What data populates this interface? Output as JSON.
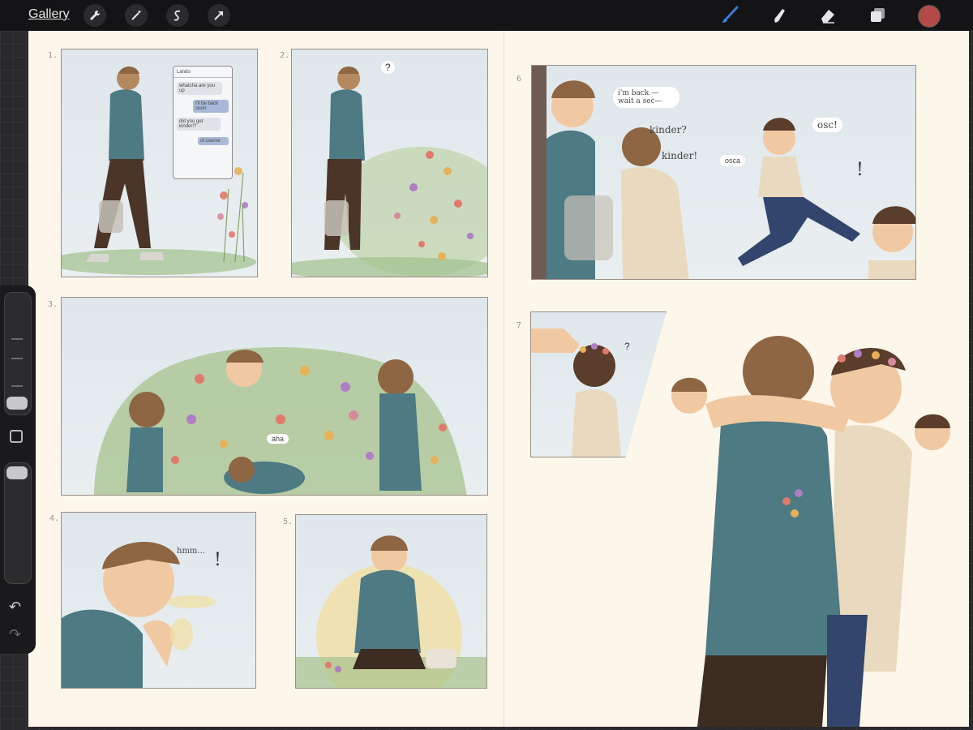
{
  "toolbar": {
    "gallery_label": "Gallery",
    "left_tools": [
      "wrench-icon",
      "magic-wand-icon",
      "selection-icon",
      "transform-arrow-icon"
    ],
    "right_tools": [
      "brush-icon",
      "smudge-icon",
      "eraser-icon",
      "layers-icon"
    ],
    "brush_color": "#b44a48",
    "active_tool_color": "#3a7bd5"
  },
  "panels": {
    "p1_number": "1.",
    "p2_number": "2.",
    "p3_number": "3.",
    "p4_number": "4.",
    "p5_number": "5.",
    "p6_number": "6",
    "p7_number": "7"
  },
  "phone_chat": {
    "header": "Lando",
    "messages": [
      "whatcha are you up",
      "I'll be back soon",
      "did you get kinder!?",
      "of course"
    ]
  },
  "speech": {
    "p2_question": "?",
    "p3_aha": "aha",
    "p4_hmm": "hmm...",
    "p4_exclaim": "!",
    "p6_back": "i'm back — wait a sec—",
    "p6_kinder1": "kinder?",
    "p6_kinder2": "kinder!",
    "p6_osca": "osca",
    "p6_osc": "osc!",
    "p6_exclaim": "!",
    "p7_question": "?"
  }
}
